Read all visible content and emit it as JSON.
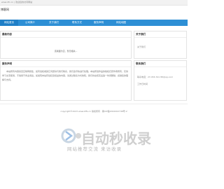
{
  "topbar": {
    "text": "www.dfc.cn | 欢迎您的访问网站"
  },
  "header": {
    "logo_text": "博客网"
  },
  "nav": {
    "items": [
      {
        "label": "网站首页",
        "active": true
      },
      {
        "label": "公司简介",
        "active": false
      },
      {
        "label": "关于我们",
        "active": false
      },
      {
        "label": "联系方式",
        "active": false
      },
      {
        "label": "服务声明",
        "active": false
      },
      {
        "label": "网站地图",
        "active": false
      }
    ]
  },
  "sections": {
    "latest": {
      "title": "最新内容",
      "notice": "该版面为空，暂无相关..."
    },
    "about": {
      "title": "关于我们",
      "text": "关于我们"
    },
    "statement": {
      "title": "服务声明",
      "text": "本站所有内容来自互联网搜集，如有侵权或其它问题请与我们联系，我们会尽快进行处理。本站所载作品的版权归原作者所有，仅供学习交流使用，不得用于商业用途。如发现本站有侵犯您权益的内容，请通过联系方式告知，我们将在核实后第一时间删除，感谢您的理解与支持。"
    },
    "contact": {
      "title": "联系我们",
      "phone": "联系电话：23 456 341  88@qq.com",
      "hours": "工作日时间"
    }
  },
  "footer": {
    "text": "copyright©2023 www.bffs.cn 版权所有 · 黑ICP备2022002748号-2"
  },
  "watermark": {
    "title": "自动秒收录",
    "subtitle": "网站推荐交流 来访收录"
  }
}
